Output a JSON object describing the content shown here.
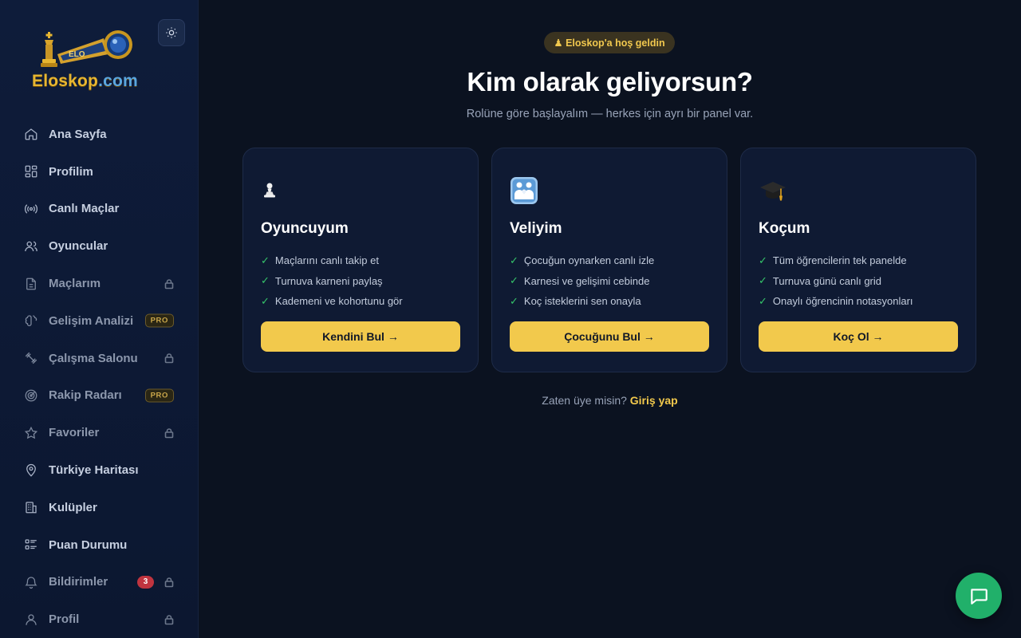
{
  "brand": {
    "name_main": "Eloskop",
    "name_suffix": ".com",
    "colors": {
      "gold": "#e7b631",
      "accent": "#f2c94c",
      "background": "#0b1220"
    }
  },
  "sidebar": {
    "items": [
      {
        "label": "Ana Sayfa",
        "icon": "home-icon"
      },
      {
        "label": "Profilim",
        "icon": "dashboard-icon"
      },
      {
        "label": "Canlı Maçlar",
        "icon": "broadcast-icon"
      },
      {
        "label": "Oyuncular",
        "icon": "users-icon"
      },
      {
        "label": "Maçlarım",
        "icon": "document-icon",
        "locked": true
      },
      {
        "label": "Gelişim Analizi",
        "icon": "brain-icon",
        "badge": "PRO"
      },
      {
        "label": "Çalışma Salonu",
        "icon": "dumbbell-icon",
        "locked": true
      },
      {
        "label": "Rakip Radarı",
        "icon": "radar-icon",
        "badge": "PRO"
      },
      {
        "label": "Favoriler",
        "icon": "star-icon",
        "locked": true
      },
      {
        "label": "Türkiye Haritası",
        "icon": "map-pin-icon"
      },
      {
        "label": "Kulüpler",
        "icon": "building-icon"
      },
      {
        "label": "Puan Durumu",
        "icon": "list-icon"
      },
      {
        "label": "Bildirimler",
        "icon": "bell-icon",
        "count": "3",
        "locked": true
      },
      {
        "label": "Profil",
        "icon": "user-icon",
        "locked": true
      }
    ]
  },
  "main": {
    "welcome": "♟ Eloskop'a hoş geldin",
    "title": "Kim olarak geliyorsun?",
    "subtitle": "Rolüne göre başlayalım — herkes için ayrı bir panel var.",
    "cards": [
      {
        "emoji": "pawn-icon",
        "title": "Oyuncuyum",
        "features": [
          "Maçlarını canlı takip et",
          "Turnuva karneni paylaş",
          "Kademeni ve kohortunu gör"
        ],
        "cta": "Kendini Bul →"
      },
      {
        "emoji": "family-icon",
        "title": "Veliyim",
        "features": [
          "Çocuğun oynarken canlı izle",
          "Karnesi ve gelişimi cebinde",
          "Koç isteklerini sen onayla"
        ],
        "cta": "Çocuğunu Bul →"
      },
      {
        "emoji": "graduation-cap-icon",
        "title": "Koçum",
        "features": [
          "Tüm öğrencilerin tek panelde",
          "Turnuva günü canlı grid",
          "Onaylı öğrencinin notasyonları"
        ],
        "cta": "Koç Ol →"
      }
    ],
    "login_prompt": "Zaten üye misin?",
    "login_link": "Giriş yap"
  }
}
